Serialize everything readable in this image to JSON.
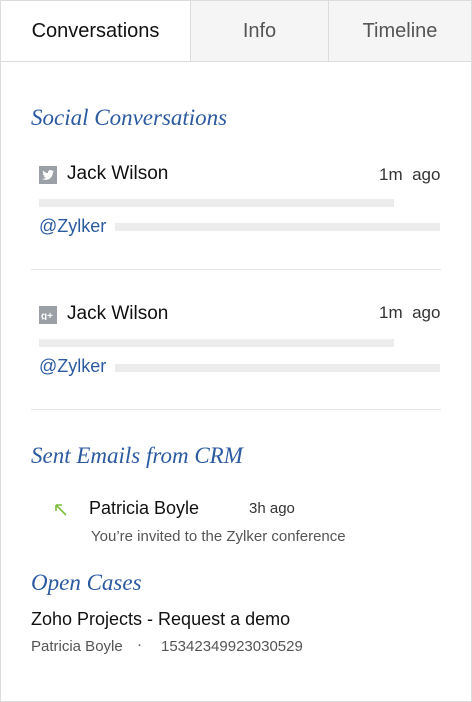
{
  "tabs": [
    {
      "label": "Conversations"
    },
    {
      "label": "Info"
    },
    {
      "label": "Timeline"
    }
  ],
  "social": {
    "title": "Social Conversations",
    "items": [
      {
        "icon": "twitter-icon",
        "name": "Jack Wilson",
        "time_value": "1m",
        "time_unit": "ago",
        "handle": "@Zylker"
      },
      {
        "icon": "google-plus-icon",
        "name": "Jack Wilson",
        "time_value": "1m",
        "time_unit": "ago",
        "handle": "@Zylker"
      }
    ]
  },
  "emails": {
    "title": "Sent Emails from CRM",
    "items": [
      {
        "icon": "sent-arrow-icon",
        "name": "Patricia Boyle",
        "time": "3h ago",
        "subject": "You’re invited to the Zylker conference"
      }
    ]
  },
  "cases": {
    "title": "Open Cases",
    "items": [
      {
        "title": "Zoho Projects - Request a demo",
        "owner": "Patricia Boyle",
        "separator": "·",
        "number": "15342349923030529"
      }
    ]
  },
  "colors": {
    "accent": "#2b5aa0",
    "icon_gray": "#9aa0a6",
    "sent_arrow": "#7cbf3a",
    "placeholder": "#ececec"
  }
}
